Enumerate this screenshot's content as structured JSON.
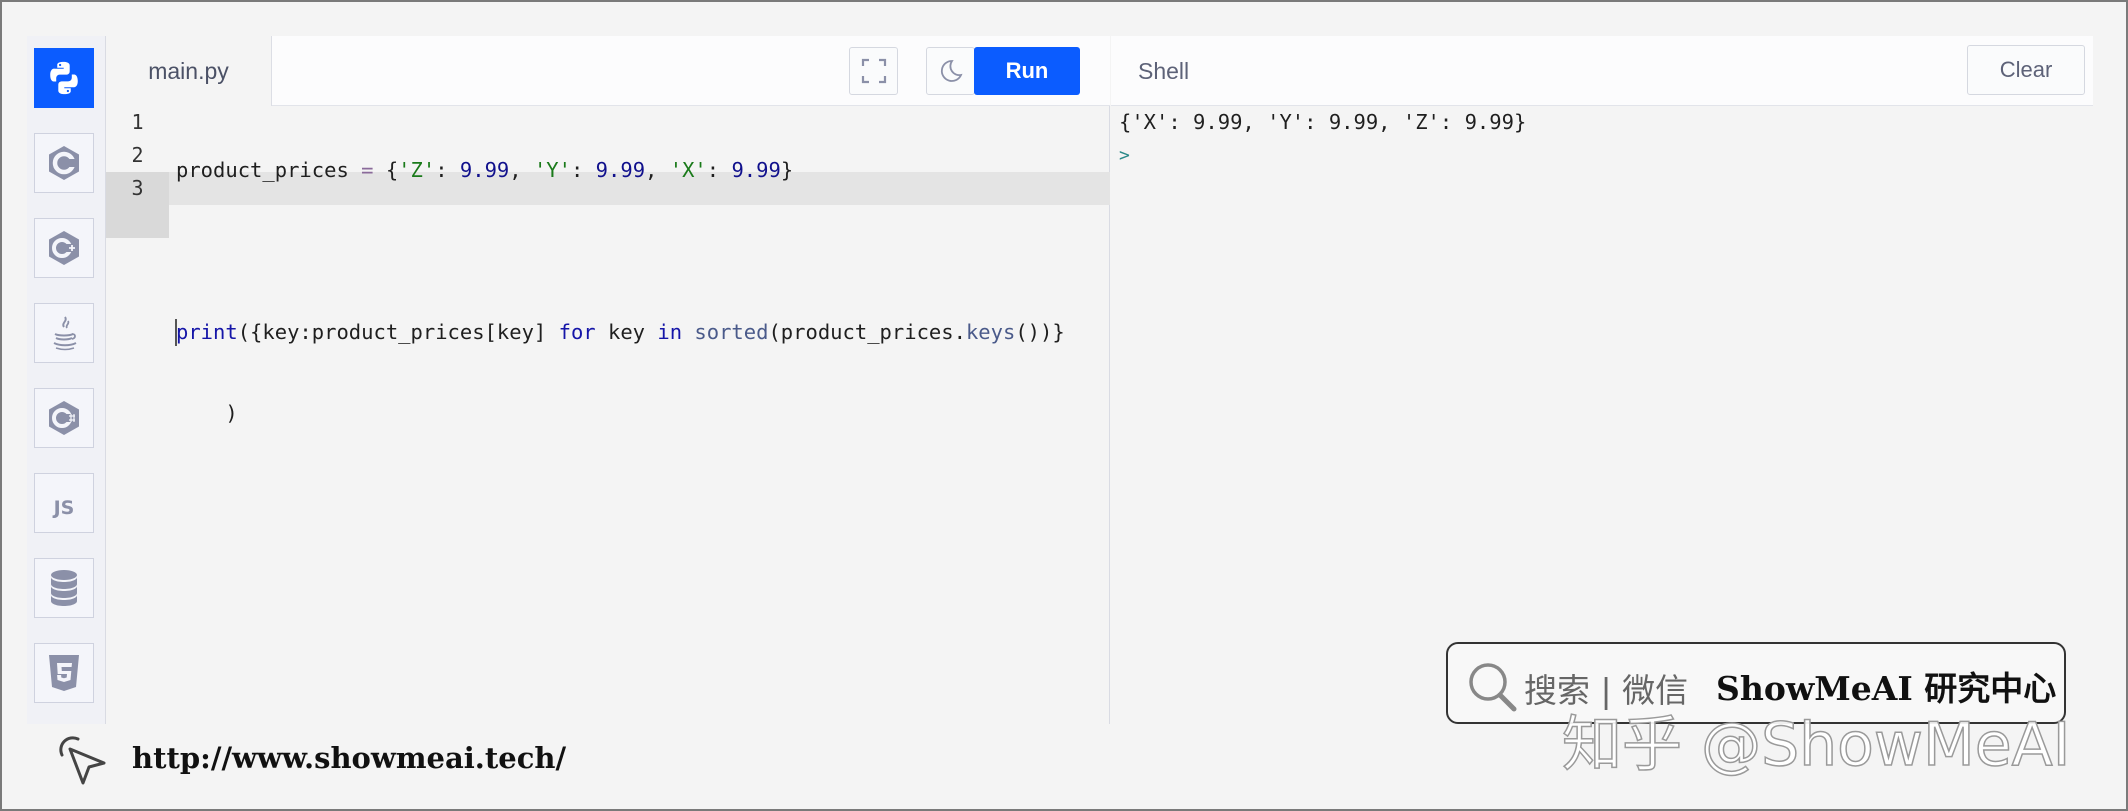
{
  "sidebar": {
    "languages": [
      {
        "name": "Python",
        "icon": "python-icon",
        "active": true
      },
      {
        "name": "C",
        "icon": "c-icon"
      },
      {
        "name": "C++",
        "icon": "cpp-icon"
      },
      {
        "name": "Java",
        "icon": "java-icon"
      },
      {
        "name": "C#",
        "icon": "csharp-icon"
      },
      {
        "name": "JavaScript",
        "icon": "js-icon",
        "label": "JS"
      },
      {
        "name": "Database",
        "icon": "database-icon"
      },
      {
        "name": "HTML5",
        "icon": "html5-icon"
      }
    ]
  },
  "editor": {
    "tab_label": "main.py",
    "run_label": "Run",
    "line_numbers": [
      "1",
      "2",
      "3"
    ],
    "active_line": 3
  },
  "shell": {
    "title": "Shell",
    "clear_label": "Clear",
    "output": "{'X': 9.99, 'Y': 9.99, 'Z': 9.99}",
    "prompt": ">"
  },
  "footer": {
    "url": "http://www.showmeai.tech/"
  },
  "watermark": {
    "search_text": "搜索 | 微信",
    "brand": "ShowMeAI 研究中心",
    "zhihu": "知乎 @ShowMeAI"
  },
  "colors": {
    "accent": "#0b5cff",
    "keyword": "#1515a8",
    "string": "#1a7a1a"
  }
}
